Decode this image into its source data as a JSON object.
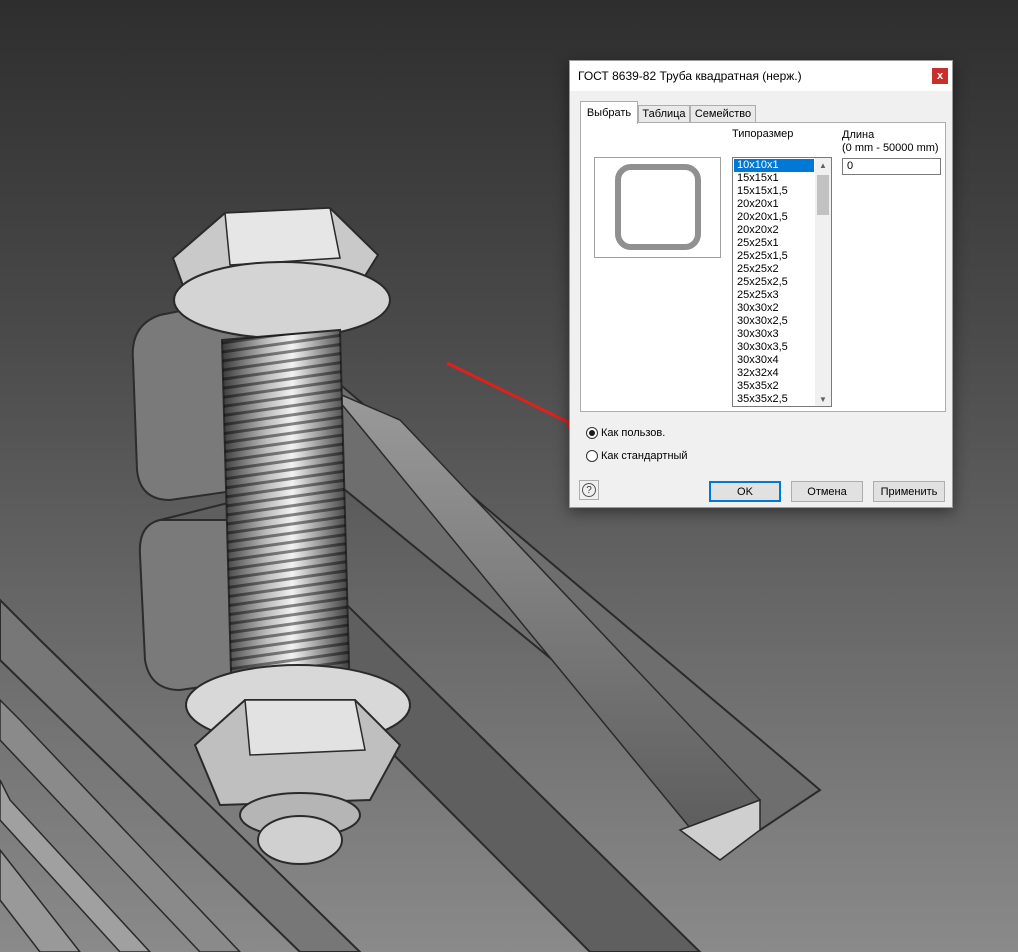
{
  "dialog": {
    "title": "ГОСТ 8639-82 Труба квадратная (нерж.)",
    "close_label": "x",
    "tabs": [
      {
        "label": "Выбрать",
        "active": true
      },
      {
        "label": "Таблица",
        "active": false
      },
      {
        "label": "Семейство",
        "active": false
      }
    ],
    "size_label": "Типоразмер",
    "length_label": "Длина",
    "length_range": "(0 mm - 50000 mm)",
    "length_value": "0",
    "sizes": [
      "10x10x1",
      "15x15x1",
      "15x15x1,5",
      "20x20x1",
      "20x20x1,5",
      "20x20x2",
      "25x25x1",
      "25x25x1,5",
      "25x25x2",
      "25x25x2,5",
      "25x25x3",
      "30x30x2",
      "30x30x2,5",
      "30x30x3",
      "30x30x3,5",
      "30x30x4",
      "32x32x4",
      "35x35x2",
      "35x35x2,5"
    ],
    "selected_size": "10x10x1",
    "radio_custom": "Как пользов.",
    "radio_standard": "Как стандартный",
    "radio_selected": "custom",
    "help_icon": "?",
    "ok_label": "OK",
    "cancel_label": "Отмена",
    "apply_label": "Применить"
  },
  "colors": {
    "accent": "#0078d7",
    "arrow": "#e0201c",
    "close": "#c7302b"
  },
  "icons": {
    "close": "close-icon",
    "help": "help-icon",
    "scroll_up": "chevron-up-icon",
    "scroll_down": "chevron-down-icon"
  }
}
